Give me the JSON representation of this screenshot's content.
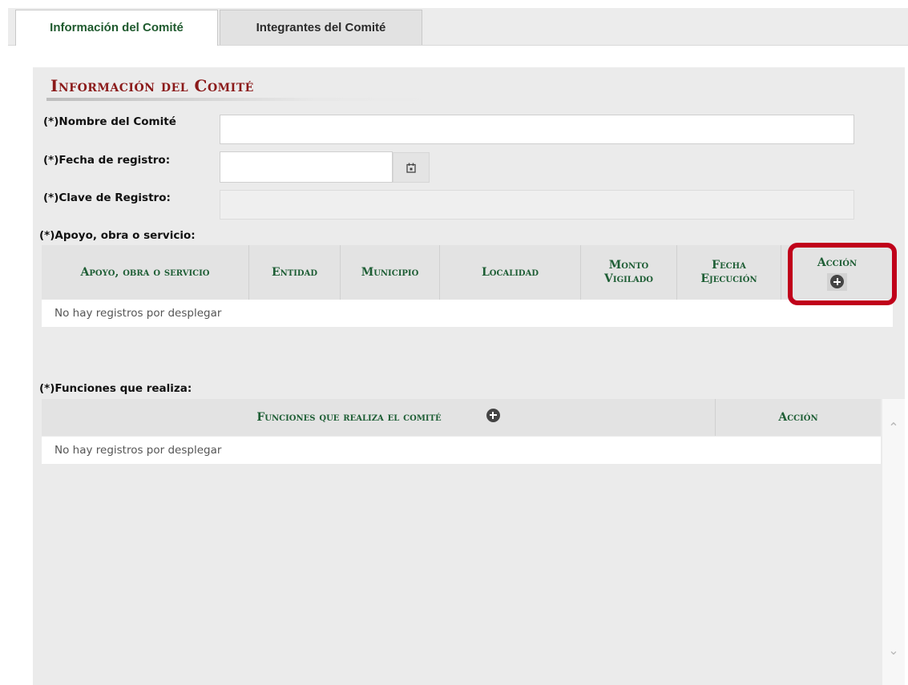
{
  "tabs": [
    {
      "label": "Información del Comité",
      "active": true
    },
    {
      "label": "Integrantes del Comité",
      "active": false
    }
  ],
  "section": {
    "title": "Información del Comité"
  },
  "form": {
    "nombre_label": "(*)Nombre del Comité",
    "nombre_value": "",
    "fecha_label": "(*)Fecha de registro:",
    "fecha_value": "",
    "clave_label": "(*)Clave de Registro:",
    "clave_value": ""
  },
  "apoyo": {
    "label": "(*)Apoyo, obra o servicio:",
    "headers": [
      "Apoyo, obra o servicio",
      "Entidad",
      "Municipio",
      "Localidad",
      "Monto Vigilado",
      "Fecha Ejecución",
      "Acción"
    ],
    "empty_text": "No hay registros por desplegar"
  },
  "funciones": {
    "label": "(*)Funciones que realiza:",
    "headers": [
      "Funciones que realiza el comité",
      "Acción"
    ],
    "empty_text": "No hay registros por desplegar"
  },
  "icons": {
    "calendar": "calendar-icon",
    "add": "plus-circle-icon",
    "scroll_up": "chevron-up-icon",
    "scroll_down": "chevron-down-icon"
  },
  "colors": {
    "header_text": "#1e5e35",
    "section_title": "#8b1a1a",
    "highlight": "#c0001a"
  }
}
